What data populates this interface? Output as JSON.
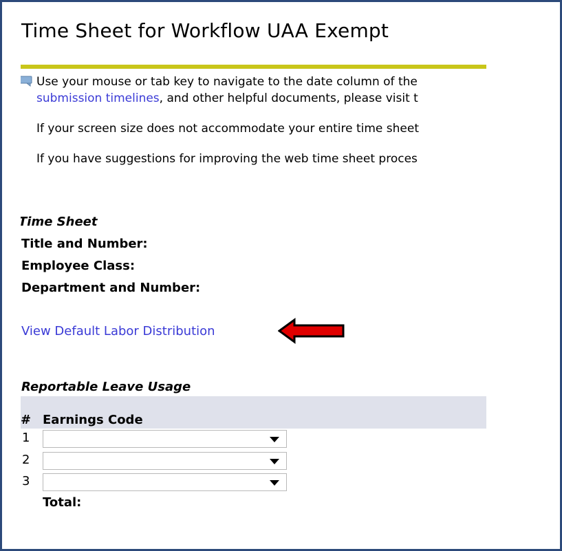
{
  "page": {
    "title": "Time Sheet for Workflow UAA Exempt"
  },
  "info": {
    "line1": "Use your mouse or tab key to navigate to the date column of the",
    "line2_link": "submission timelines",
    "line2_rest": ", and other helpful documents, please visit t",
    "p2": "If your screen size does not accommodate your entire time sheet",
    "p3": "If you have suggestions for improving the web time sheet proces"
  },
  "timesheet": {
    "section_label": "Time Sheet",
    "fields": [
      {
        "label": "Title and Number:"
      },
      {
        "label": "Employee Class:"
      },
      {
        "label": "Department and Number:"
      }
    ],
    "labor_link": "View Default Labor Distribution"
  },
  "leave": {
    "section_label": "Reportable Leave Usage",
    "columns": [
      "#",
      "Earnings Code"
    ],
    "rows": [
      {
        "num": "1",
        "value": ""
      },
      {
        "num": "2",
        "value": ""
      },
      {
        "num": "3",
        "value": ""
      }
    ],
    "total_label": "Total:"
  },
  "colors": {
    "frame_border": "#2d4a7a",
    "title_rule": "#c9c61a",
    "link": "#3a3ad6",
    "header_band": "#dfe1eb",
    "arrow_fill": "#e00000"
  },
  "icons": {
    "info": "comment-bubble-icon",
    "arrow": "red-left-arrow-icon",
    "dropdown": "chevron-down-icon"
  }
}
